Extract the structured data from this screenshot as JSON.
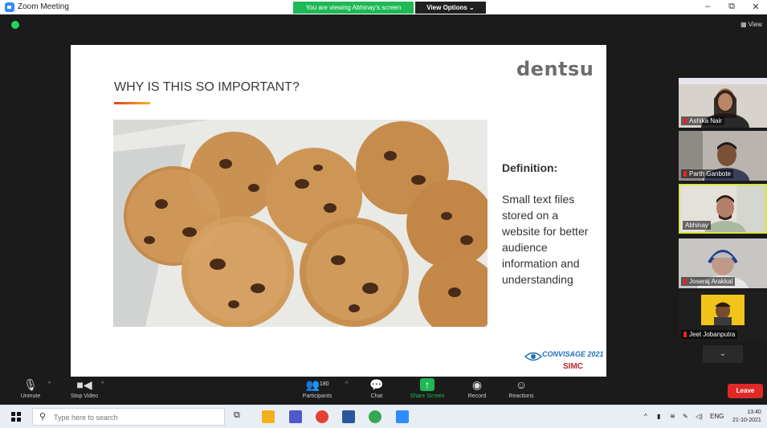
{
  "window": {
    "title": "Zoom Meeting",
    "viewing_banner": "You are viewing Abhinay's screen",
    "view_options_label": "View Options ⌄",
    "minimize": "–",
    "maximize": "⧉",
    "close": "✕",
    "view_button": "View"
  },
  "slide": {
    "brand": "dentsu",
    "title": "WHY IS THIS SO IMPORTANT?",
    "definition_title": "Definition:",
    "definition_text": "Small text files stored on a website for better audience information and understanding",
    "logo_convisage": "CONVISAGE 2021",
    "logo_simc": "SIMC"
  },
  "participants": [
    {
      "name": "Ashika Nair",
      "active": false
    },
    {
      "name": "Parth Ganbote",
      "active": false
    },
    {
      "name": "Abhinay",
      "active": true
    },
    {
      "name": "Joseraj Arakkal",
      "active": false
    },
    {
      "name": "Jeet Jobanputra",
      "active": false
    }
  ],
  "toolbar": {
    "unmute": "Unmute",
    "stop_video": "Stop Video",
    "participants": "Participants",
    "participants_count": "180",
    "chat": "Chat",
    "share_screen": "Share Screen",
    "record": "Record",
    "reactions": "Reactions",
    "leave": "Leave"
  },
  "taskbar": {
    "search_placeholder": "Type here to search",
    "language": "ENG",
    "time": "13:40",
    "date": "21-10-2021"
  },
  "colors": {
    "banner_green": "#1db954",
    "leave_red": "#e02828",
    "active_speaker_border": "#d6e83a",
    "zoom_blue": "#2d8cff"
  }
}
